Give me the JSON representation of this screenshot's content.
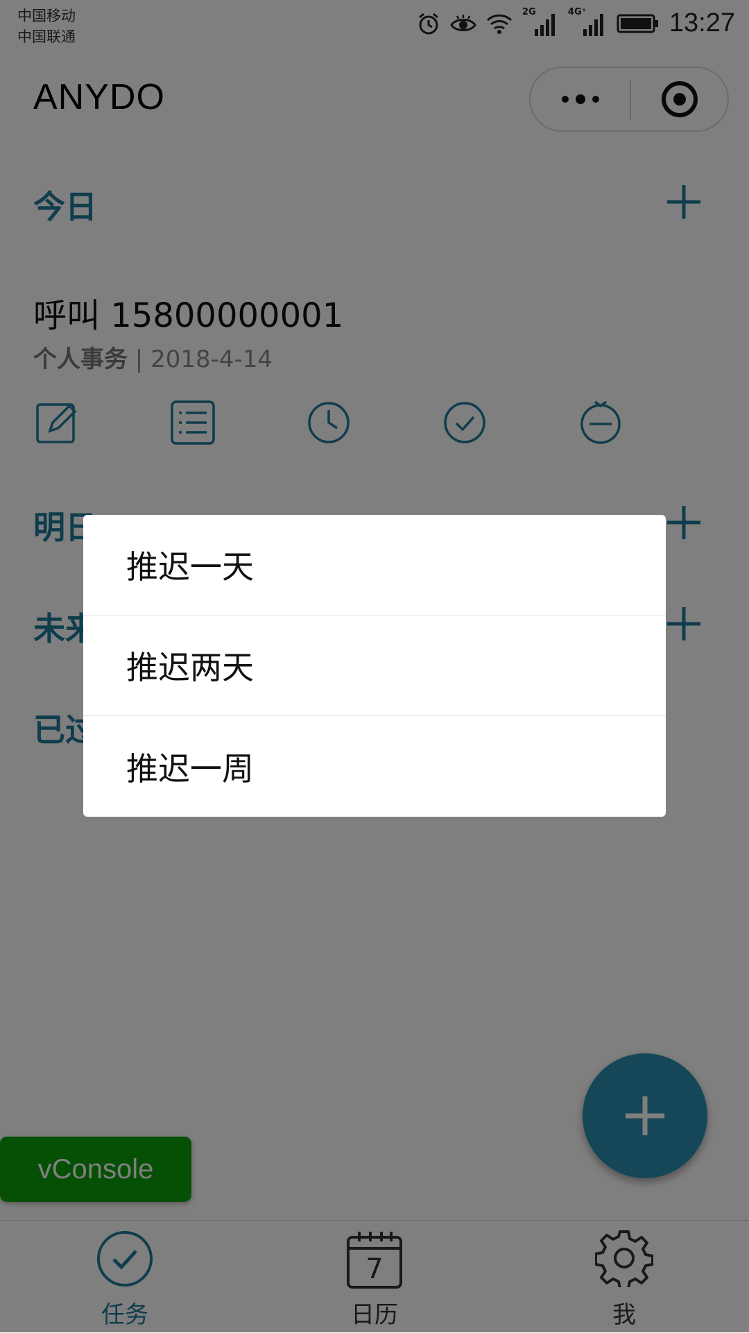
{
  "status_bar": {
    "carrier_1": "中国移动",
    "carrier_2": "中国联通",
    "signal_1_label": "2G",
    "signal_2_label": "4G⁺",
    "time": "13:27"
  },
  "header": {
    "title": "ANYDO"
  },
  "sections": {
    "today": "今日",
    "tomorrow": "明日",
    "future": "未来",
    "overdue": "已过"
  },
  "task": {
    "title": "呼叫 15800000001",
    "category": "个人事务",
    "separator": " | ",
    "date": "2018-4-14"
  },
  "postpone_menu": {
    "items": [
      "推迟一天",
      "推迟两天",
      "推迟一周"
    ]
  },
  "vconsole": {
    "label": "vConsole"
  },
  "tabbar": {
    "tasks": "任务",
    "calendar": "日历",
    "calendar_day": "7",
    "me": "我"
  },
  "colors": {
    "accent": "#1f7a9a",
    "fab": "#2a8fb1",
    "vconsole": "#0aa00a"
  }
}
